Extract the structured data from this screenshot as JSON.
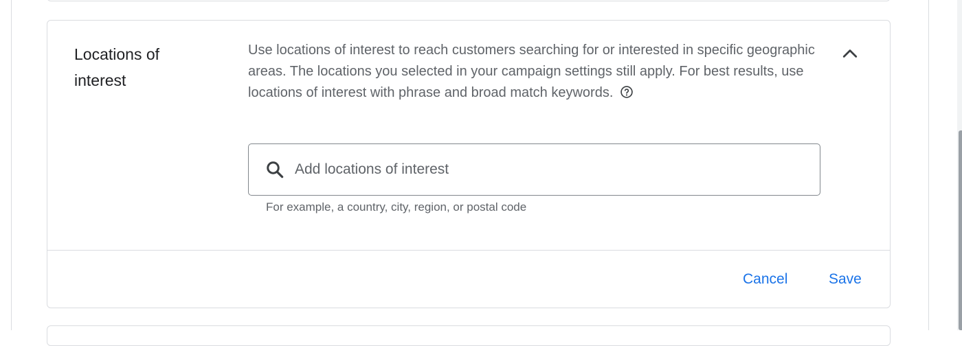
{
  "section": {
    "title": "Locations of interest",
    "description": "Use locations of interest to reach customers searching for or interested in specific geographic areas. The locations you selected in your campaign settings still apply. For best results, use locations of interest with phrase and broad match keywords."
  },
  "icons": {
    "help": "help-circle-icon",
    "collapse": "chevron-up-icon",
    "search": "search-icon"
  },
  "search": {
    "value": "",
    "placeholder": "Add locations of interest",
    "hint": "For example, a country, city, region, or postal code"
  },
  "footer": {
    "cancel_label": "Cancel",
    "save_label": "Save"
  },
  "colors": {
    "accent": "#1a73e8",
    "text_primary": "#202124",
    "text_secondary": "#5f6368",
    "border": "#dadce0"
  }
}
